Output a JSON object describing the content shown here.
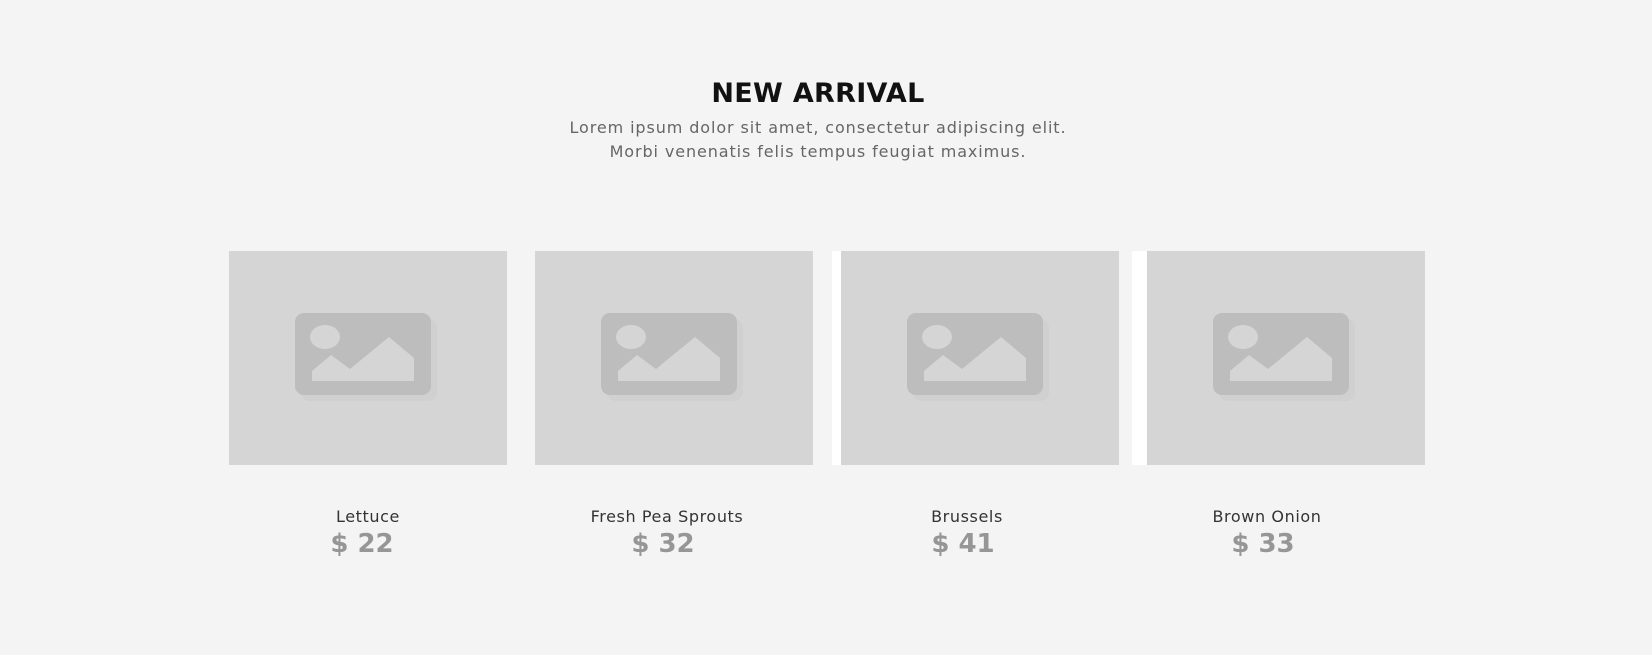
{
  "section": {
    "title": "NEW ARRIVAL",
    "subtitle_line1": "Lorem ipsum dolor sit amet, consectetur adipiscing elit.",
    "subtitle_line2": "Morbi venenatis felis tempus feugiat maximus."
  },
  "products": [
    {
      "name": "Lettuce",
      "price": "$ 22",
      "icon": "image-placeholder-icon"
    },
    {
      "name": "Fresh Pea Sprouts",
      "price": "$ 32",
      "icon": "image-placeholder-icon"
    },
    {
      "name": "Brussels",
      "price": "$ 41",
      "icon": "image-placeholder-icon"
    },
    {
      "name": "Brown Onion",
      "price": "$ 33",
      "icon": "image-placeholder-icon"
    }
  ],
  "colors": {
    "background": "#f4f4f4",
    "placeholder_bg": "#d5d5d5",
    "placeholder_icon": "#bdbdbd",
    "title": "#111111",
    "price": "#969696"
  }
}
